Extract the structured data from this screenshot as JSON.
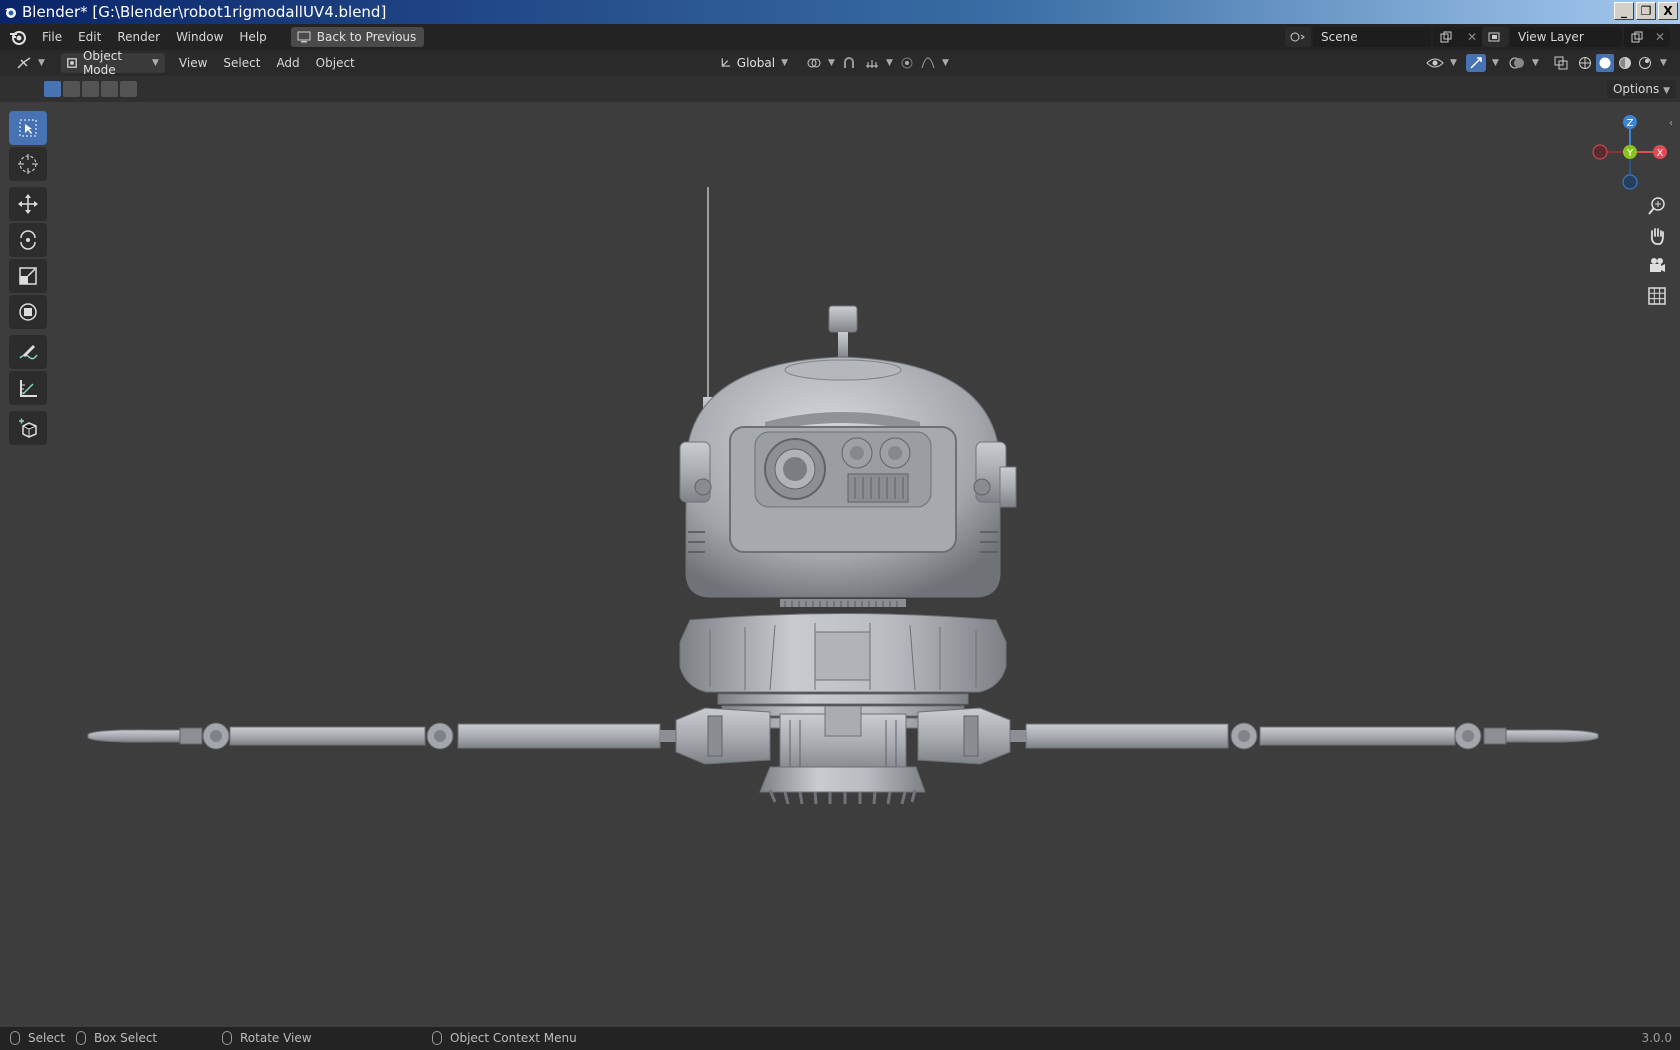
{
  "window": {
    "title": "Blender* [G:\\Blender\\robot1rigmodallUV4.blend]",
    "buttons": [
      "_",
      "❐",
      "X"
    ]
  },
  "menubar": {
    "items": [
      "File",
      "Edit",
      "Render",
      "Window",
      "Help"
    ],
    "back_button": "Back to Previous",
    "scene": "Scene",
    "view_layer": "View Layer"
  },
  "header": {
    "mode": "Object Mode",
    "menus": [
      "View",
      "Select",
      "Add",
      "Object"
    ],
    "orientation": "Global"
  },
  "subbar": {
    "options_label": "Options"
  },
  "gizmo": {
    "z": "Z",
    "y": "Y",
    "x": "X"
  },
  "statusbar": {
    "select": "Select",
    "box_select": "Box Select",
    "rotate_view": "Rotate View",
    "context_menu": "Object Context Menu",
    "version": "3.0.0"
  },
  "colors": {
    "accent": "#4772b3",
    "viewport_bg": "#3d3d3d",
    "axis_x": "#e04a52",
    "axis_y": "#8bc220",
    "axis_z": "#3b84d8"
  },
  "icons": [
    "blender-logo-icon",
    "back-icon",
    "scene-icon",
    "view-layer-icon",
    "editor-type-icon",
    "object-mode-icon",
    "transform-orientation-icon",
    "pivot-icon",
    "snap-icon",
    "proportional-edit-icon",
    "visibility-icon",
    "gizmo-icon",
    "overlay-icon",
    "xray-icon",
    "shading-wireframe-icon",
    "shading-solid-icon",
    "shading-material-icon",
    "shading-rendered-icon",
    "select-box-icon",
    "cursor-icon",
    "move-icon",
    "rotate-icon",
    "scale-icon",
    "transform-icon",
    "annotate-icon",
    "measure-icon",
    "add-cube-icon",
    "zoom-icon",
    "pan-icon",
    "camera-icon",
    "grid-icon"
  ]
}
